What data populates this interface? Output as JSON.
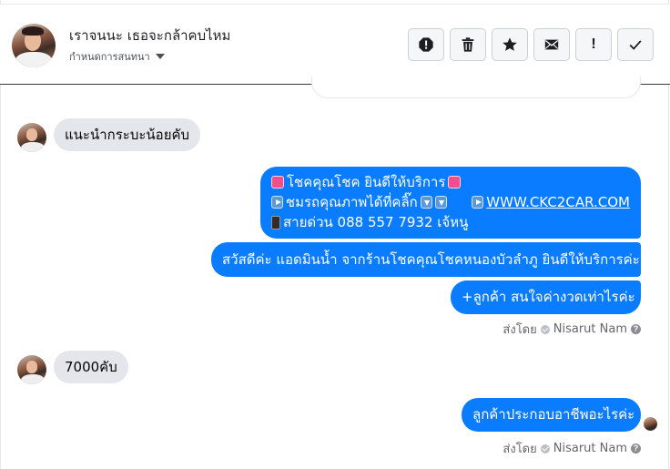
{
  "header": {
    "contact_name": "เราจนนะ เธอจะกล้าคบไหม",
    "subtitle": "กำหนดการสนทนา",
    "toolbar": [
      {
        "name": "spam-button",
        "icon": "exclamation-octagon-icon"
      },
      {
        "name": "delete-button",
        "icon": "trash-icon"
      },
      {
        "name": "star-button",
        "icon": "star-icon"
      },
      {
        "name": "mark-unread-button",
        "icon": "envelope-icon"
      },
      {
        "name": "priority-button",
        "icon": "exclamation-icon",
        "label": "!"
      },
      {
        "name": "done-button",
        "icon": "check-icon"
      }
    ]
  },
  "messages": {
    "m1": {
      "text": "แนะนำกระบะน้อยคับ"
    },
    "m2": {
      "line1": "โชคคุณโชค ยินดีให้บริการ",
      "line2": "ชมรถคุณภาพได้ที่คลิ๊ก",
      "link": "WWW.CKC2CAR.COM",
      "line3": "สายด่วน 088 557 7932 เจ้หนู"
    },
    "m3": {
      "text": "สวัสดีค่ะ แอดมินน้ำ จากร้านโชคคุณโชคหนองบัวลำภู ยินดีให้บริการค่ะ"
    },
    "m4": {
      "text": "+ลูกค้า สนใจค่างวดเท่าไรค่ะ"
    },
    "m5": {
      "text": "7000คับ"
    },
    "m6": {
      "text": "ลูกค้าประกอบอาชีพอะไรค่ะ"
    }
  },
  "sent_by": {
    "prefix": "ส่งโดย",
    "name": "Nisarut Nam",
    "help": "?"
  }
}
